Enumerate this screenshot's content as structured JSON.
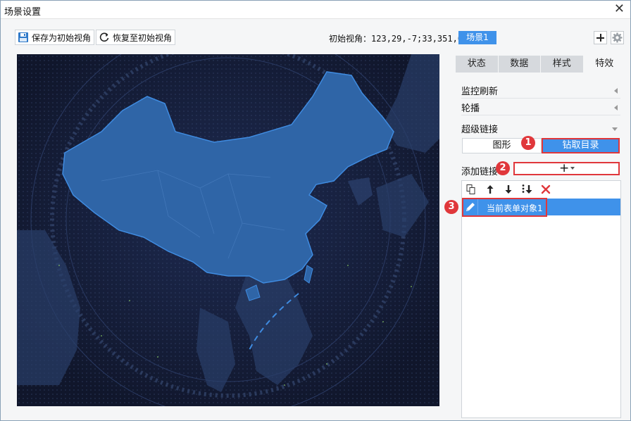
{
  "window": {
    "title": "场景设置",
    "close_label": "✕"
  },
  "toolbar": {
    "save_label": "保存为初始视角",
    "restore_label": "恢复至初始视角",
    "initial_view_label": "初始视角：",
    "initial_view_value": "123,29,-7;33,351,0",
    "scene_label": "场景1",
    "add_icon": "plus-icon",
    "settings_icon": "gear-icon"
  },
  "tabs": [
    {
      "label": "状态",
      "active": false
    },
    {
      "label": "数据",
      "active": false
    },
    {
      "label": "样式",
      "active": false
    },
    {
      "label": "特效",
      "active": true
    }
  ],
  "sections": {
    "monitor_refresh": "监控刷新",
    "carousel": "轮播",
    "hyperlink": "超级链接"
  },
  "hyperlink": {
    "mode_options": [
      "图形",
      "钻取目录"
    ],
    "selected_mode": "钻取目录",
    "add_link_label": "添加链接",
    "add_button": "+",
    "list_tools": [
      "copy-icon",
      "arrow-up-icon",
      "arrow-down-icon",
      "move-bottom-icon",
      "delete-icon"
    ],
    "items": [
      {
        "label": "当前表单对象1",
        "selected": true
      }
    ]
  },
  "callouts": [
    "1",
    "2",
    "3"
  ],
  "colors": {
    "accent": "#3f92ea",
    "highlight": "#e0373b",
    "map_background": "#141b34",
    "map_land": "#2f65a7"
  }
}
